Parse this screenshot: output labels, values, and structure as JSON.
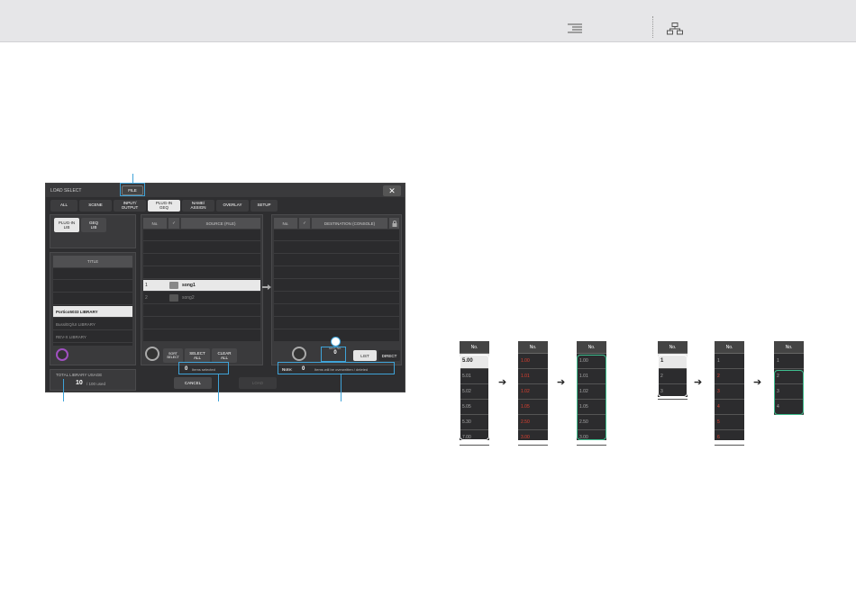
{
  "dialog": {
    "title": "LOAD SELECT",
    "file_button": "FILE",
    "close_label": "✕",
    "tabs": [
      "ALL",
      "SCENE",
      "INPUT/\nOUTPUT",
      "PLUG-IN\nGEQ",
      "NAME/\nASSIGN",
      "OVERLAY",
      "SETUP"
    ],
    "left": {
      "mode_buttons": [
        "PLUG-IN\nLIB",
        "GEQ\nLIB"
      ],
      "title_header": "TITLE",
      "libraries": [
        "Portico5033 LIBRARY",
        "Buss/EQ/UI LIBRARY",
        "REV-X LIBRARY"
      ],
      "usage_label": "TOTAL LIBRARY USAGE",
      "usage_value": "10",
      "usage_suffix": "/ 100 used"
    },
    "source": {
      "headers": [
        "No.",
        "✓",
        "SOURCE (FILE)"
      ],
      "rows": [
        {
          "no": "1",
          "name": "song1"
        },
        {
          "no": "2",
          "name": "song2"
        }
      ],
      "select_button": "SELECT\nALL",
      "clear_button": "CLEAR\nALL",
      "sort_button": "SORT\nSELECT",
      "selected_count": "0",
      "selected_label": "Items selected"
    },
    "destination": {
      "headers": [
        "No.",
        "✓",
        "DESTINATION (CONSOLE)"
      ],
      "lock_icon": "lock-icon",
      "arrow_icon": "right-arrow-icon",
      "note_label": "Note:",
      "note_count": "0",
      "note_text": "Items will be overwritten / deleted",
      "idle_label": "IDLE No.",
      "idle_value": "0",
      "list_button": "LIST",
      "direct_button": "DIRECT"
    },
    "cancel_button": "CANCEL",
    "load_button": "LOAD"
  },
  "diagram1": {
    "header": "No.",
    "col1": [
      "5.00",
      "5.01",
      "5.02",
      "5.05",
      "5.30",
      "7.00"
    ],
    "col2": [
      "1.00",
      "1.01",
      "1.02",
      "1.05",
      "2.50",
      "3.00"
    ],
    "col3": [
      "1.00",
      "1.01",
      "1.02",
      "1.05",
      "2.50",
      "3.00"
    ]
  },
  "diagram2": {
    "header": "No.",
    "col1": [
      "1",
      "2",
      "3"
    ],
    "col2": [
      "1",
      "2",
      "3",
      "4",
      "5",
      "6"
    ],
    "col3": [
      "1",
      "2",
      "3",
      "4"
    ]
  }
}
